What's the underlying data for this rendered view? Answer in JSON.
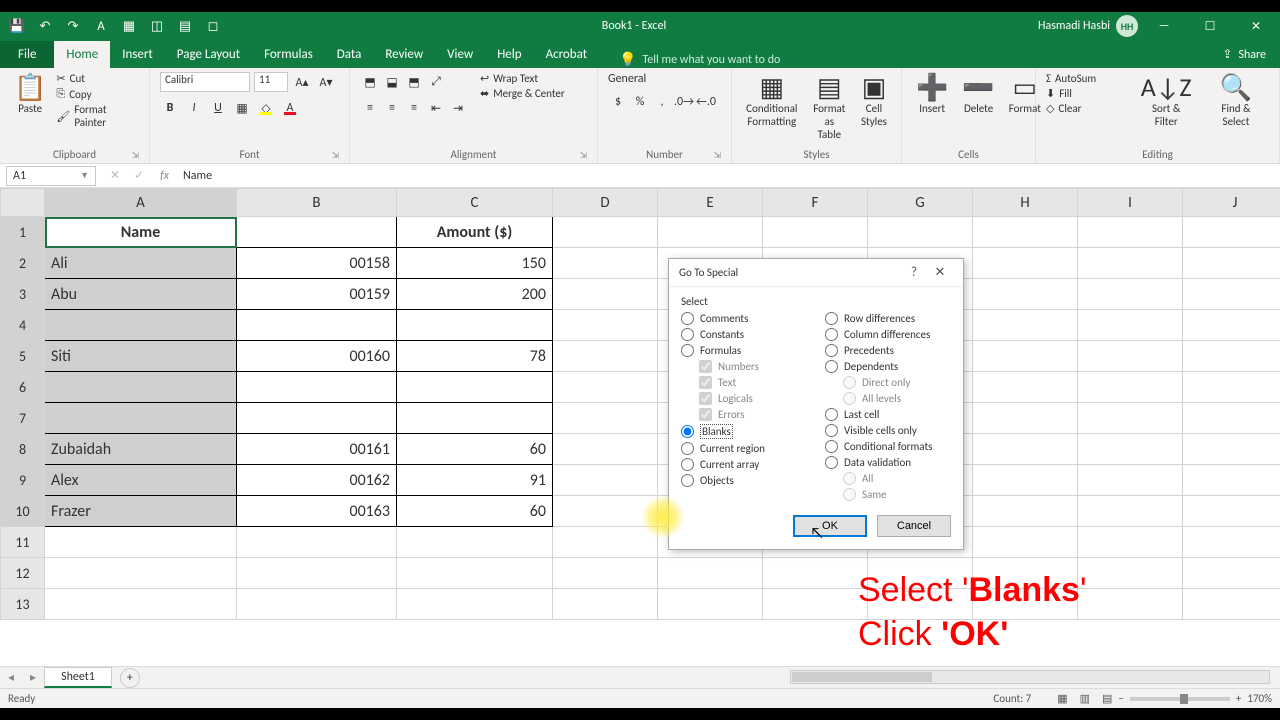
{
  "titlebar": {
    "title": "Book1 - Excel",
    "user": "Hasmadi Hasbi",
    "avatar": "HH"
  },
  "tabs": {
    "file": "File",
    "items": [
      "Home",
      "Insert",
      "Page Layout",
      "Formulas",
      "Data",
      "Review",
      "View",
      "Help",
      "Acrobat"
    ],
    "active": "Home",
    "tellme": "Tell me what you want to do",
    "share": "Share"
  },
  "ribbon": {
    "clipboard": {
      "label": "Clipboard",
      "paste": "Paste",
      "cut": "Cut",
      "copy": "Copy",
      "formatpainter": "Format Painter"
    },
    "font": {
      "label": "Font",
      "name": "Calibri",
      "size": "11"
    },
    "alignment": {
      "label": "Alignment",
      "wrap": "Wrap Text",
      "merge": "Merge & Center"
    },
    "number": {
      "label": "Number",
      "format": "General"
    },
    "styles": {
      "label": "Styles",
      "cond": "Conditional Formatting",
      "table": "Format as Table",
      "cell": "Cell Styles"
    },
    "cells": {
      "label": "Cells",
      "insert": "Insert",
      "delete": "Delete",
      "format": "Format"
    },
    "editing": {
      "label": "Editing",
      "autosum": "AutoSum",
      "fill": "Fill",
      "clear": "Clear",
      "sort": "Sort & Filter",
      "find": "Find & Select"
    }
  },
  "formulabar": {
    "cellref": "A1",
    "value": "Name"
  },
  "columns": [
    "A",
    "B",
    "C",
    "D",
    "E",
    "F",
    "G",
    "H",
    "I",
    "J"
  ],
  "table": {
    "headers": {
      "A": "Name",
      "C": "Amount ($)"
    },
    "rows": [
      {
        "r": 1,
        "A": "Name",
        "B": "",
        "C": "Amount ($)"
      },
      {
        "r": 2,
        "A": "Ali",
        "B": "00158",
        "C": "150"
      },
      {
        "r": 3,
        "A": "Abu",
        "B": "00159",
        "C": "200"
      },
      {
        "r": 4,
        "A": "",
        "B": "",
        "C": ""
      },
      {
        "r": 5,
        "A": "Siti",
        "B": "00160",
        "C": "78"
      },
      {
        "r": 6,
        "A": "",
        "B": "",
        "C": ""
      },
      {
        "r": 7,
        "A": "",
        "B": "",
        "C": ""
      },
      {
        "r": 8,
        "A": "Zubaidah",
        "B": "00161",
        "C": "60"
      },
      {
        "r": 9,
        "A": "Alex",
        "B": "00162",
        "C": "91"
      },
      {
        "r": 10,
        "A": "Frazer",
        "B": "00163",
        "C": "60"
      }
    ]
  },
  "sheet": {
    "name": "Sheet1"
  },
  "status": {
    "ready": "Ready",
    "count": "Count: 7",
    "zoom": "170%"
  },
  "dialog": {
    "title": "Go To Special",
    "select": "Select",
    "left": [
      "Comments",
      "Constants",
      "Formulas"
    ],
    "left_sub": [
      "Numbers",
      "Text",
      "Logicals",
      "Errors"
    ],
    "left2": [
      "Blanks",
      "Current region",
      "Current array",
      "Objects"
    ],
    "right": [
      "Row differences",
      "Column differences",
      "Precedents",
      "Dependents"
    ],
    "right_sub": [
      "Direct only",
      "All levels"
    ],
    "right2": [
      "Last cell",
      "Visible cells only",
      "Conditional formats",
      "Data validation"
    ],
    "right2_sub": [
      "All",
      "Same"
    ],
    "ok": "OK",
    "cancel": "Cancel",
    "selected": "Blanks"
  },
  "annotation": {
    "l1a": "Select '",
    "l1b": "Blanks",
    "l1c": "'",
    "l2a": "Click ",
    "l2b": "'OK'"
  }
}
